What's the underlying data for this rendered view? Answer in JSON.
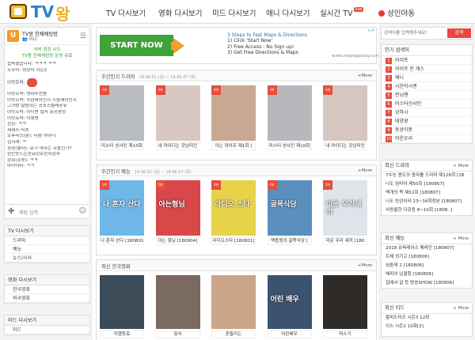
{
  "header": {
    "logo_text_1": "TV",
    "logo_text_2": "왕",
    "nav": [
      "TV 다시보기",
      "영화 다시보기",
      "미드 다시보기",
      "애니 다시보기",
      "실시간 TV"
    ],
    "live_badge": "live",
    "login_label": "성인야동"
  },
  "chat": {
    "title": "TV왕 한채채팅방",
    "count": "992",
    "notice": [
      "서버 점검 시도",
      "TV왕 전채채팅방 운영 유료"
    ],
    "lines": [
      "접속했습니다: ㅋㅋㅋ ㅋㅋ",
      "도우미: 성깡사 시즌2",
      "이맛흐락:",
      "이맛흐락: 영화추천좀",
      "이맛흐락: 스맘래이인지 스맘래이인지",
      "그거랑 잘맘하는 공포스럴레공유",
      "이맛흐락: 이니면 접사 유공편정",
      "이맛흐락: 이생명",
      "친강: ㅋㅋ",
      "세세스:딕츠",
      "오후라스(훈): 다음 야하니",
      "김시래: ㅋ",
      "정공(좋다): 요기 야하는 우분건가?",
      "왼칸웃드는깐요린로린이감사",
      "강유(조루): ㅋㅋ",
      "아이야티: ㅋㅋ"
    ],
    "input_placeholder": "채팅 입력"
  },
  "left_menus": [
    {
      "title": "TV 다시보기",
      "items": [
        "드라마",
        "예능",
        "뉴스/시사"
      ]
    },
    {
      "title": "영화 다시보기",
      "items": [
        "한국영화",
        "외국영화"
      ]
    },
    {
      "title": "미드 다시보기",
      "items": [
        "미드"
      ]
    }
  ],
  "ad": {
    "start_label": "START NOW",
    "heading": "3 Steps to Fast Maps & Directions",
    "steps": [
      "1) Click 'Start Now'",
      "2) Free Access - No Sign up!",
      "3) Get Free Directions & Maps"
    ],
    "url": "www.mapsgalaxy.com"
  },
  "sections": [
    {
      "title": "주간인기 드라마",
      "date": "18.06.01 (금) ~ 18.06.07 (목)",
      "more": "+More",
      "items": [
        {
          "caption": "미스터 션샤인 제10화",
          "tag": "3위",
          "bg": "#b9bcc0",
          "overlay": ""
        },
        {
          "caption": "내 아이디는 강남미인",
          "tag": "3위",
          "bg": "#d9c8c2",
          "overlay": ""
        },
        {
          "caption": "아는 와이프 제1화 [",
          "tag": "4위",
          "bg": "#c9a892",
          "overlay": ""
        },
        {
          "caption": "미스터 션샤인 제10화",
          "tag": "3위",
          "bg": "#b6b8bc",
          "overlay": ""
        },
        {
          "caption": "내 아이디는 강남미인",
          "tag": "3위",
          "bg": "#d6c6c0",
          "overlay": ""
        }
      ]
    },
    {
      "title": "주간인기 예능",
      "date": "18.06.01 (금) ~ 18.06.07 (목)",
      "more": "+More",
      "items": [
        {
          "caption": "나 혼자 산다 [180801]",
          "tag": "1위",
          "bg": "#6fb7e8",
          "overlay": "나 혼자 산다"
        },
        {
          "caption": "아는 형님 [180804]",
          "tag": "2위",
          "bg": "#d8474a",
          "overlay": "아는형님"
        },
        {
          "caption": "라디오스타 [180801]",
          "tag": "3위",
          "bg": "#e8d24a",
          "overlay": "라디오 스타"
        },
        {
          "caption": "백종원의 골목식당 [",
          "tag": "4위",
          "bg": "#5a8fbe",
          "overlay": "골목식당"
        },
        {
          "caption": "미운 우리 새끼 [180",
          "tag": "5위",
          "bg": "#dfe4ea",
          "overlay": "미운 우리새끼"
        }
      ]
    },
    {
      "title": "최신 한국영화",
      "date": "",
      "more": "+More",
      "items": [
        {
          "caption": "미행동료",
          "tag": "",
          "bg": "#3b4b57",
          "overlay": ""
        },
        {
          "caption": "잠식",
          "tag": "",
          "bg": "#7b6a5f",
          "overlay": ""
        },
        {
          "caption": "흔들리는 ",
          "tag": "",
          "bg": "#caa58a",
          "overlay": ""
        },
        {
          "caption": "어린배우",
          "tag": "",
          "bg": "#3c5370",
          "overlay": "어린 배우"
        },
        {
          "caption": "마스기",
          "tag": "",
          "bg": "#2f2b29",
          "overlay": ""
        }
      ]
    }
  ],
  "right": {
    "search_placeholder": "검색어를 입력해주세요!",
    "search_button": "검색",
    "popular": {
      "title": "인기 검색어",
      "items": [
        "라이프",
        "라이프 온 캐스",
        "애니",
        "시운미시엔",
        "런닝맨",
        "미스터선샤인",
        "강하시",
        "태양광",
        "동상이몽",
        "미운오리"
      ]
    },
    "latest_drama": {
      "title": "최신 드라마",
      "more": "+ More",
      "items": [
        "7수능 왕도의 왕자를 드라마 제128회 [18",
        "나도 엄마야 제50회 [180807]",
        "백개의 목 제52회 [180807]",
        "나도 빈관이라 23~34회정본 [180807]",
        "사랑콜한 다큐원 8~10회 [1808..]"
      ]
    },
    "latest_variety": {
      "title": "최신 예능",
      "more": "+ More",
      "items": [
        "2018 슈퍼레이스 퀘레진 [180807]",
        "트체 외기고 [180806]",
        "심중재 2 [180806]",
        "해피의 남결험 [180806]",
        "집에서 살 듯 방송SHOW [180806]"
      ]
    },
    "latest_us": {
      "title": "최신 미드",
      "more": "+ More",
      "items": [
        "울피도터즈 시즌3 12화",
        "이스 시즌2 10화[2]"
      ]
    }
  },
  "colors": {
    "accent_red": "#e84c3d",
    "start_green": "#3ea33a",
    "logo_blue": "#2d7fd6",
    "logo_yellow": "#f0b020"
  }
}
